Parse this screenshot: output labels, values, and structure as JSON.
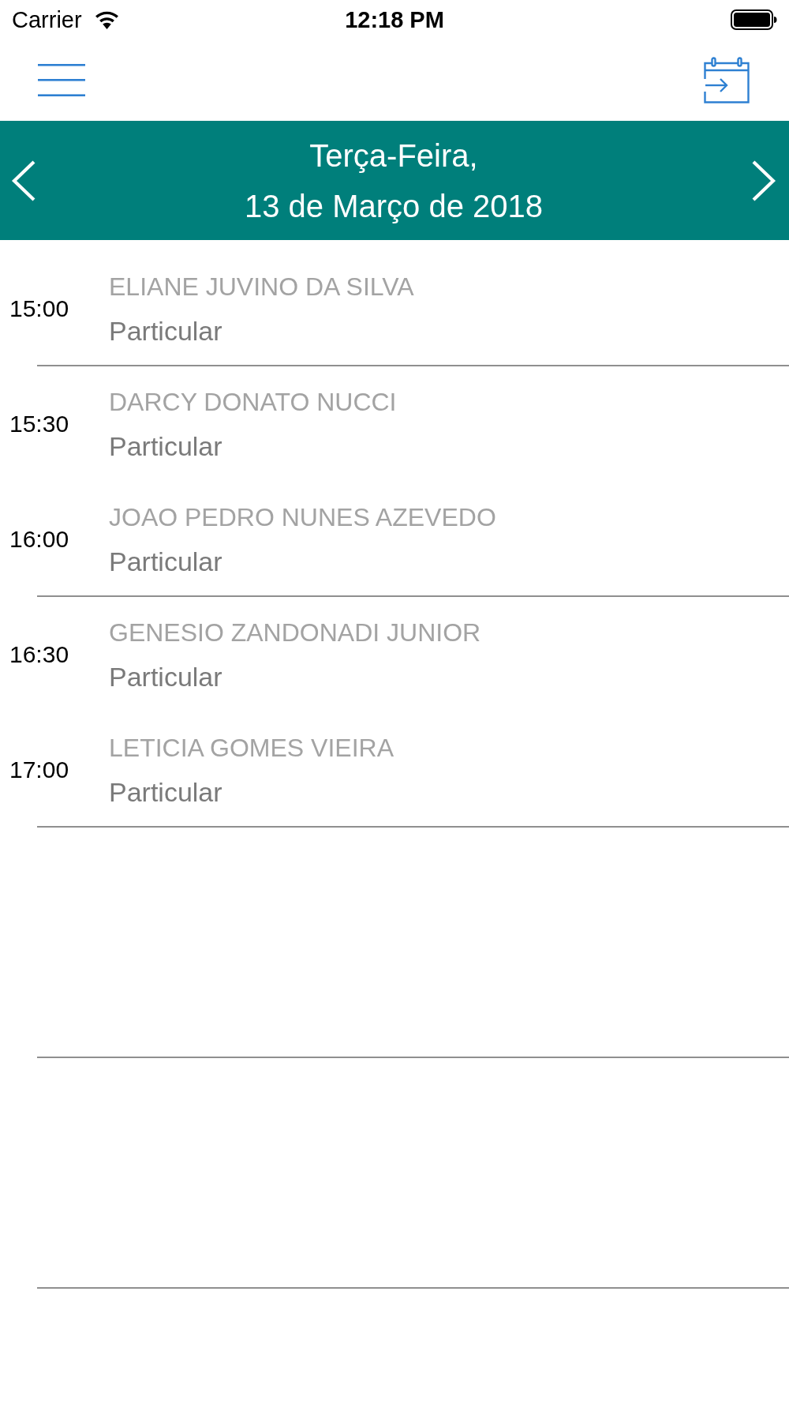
{
  "status_bar": {
    "carrier": "Carrier",
    "time": "12:18 PM"
  },
  "date_header": {
    "weekday": "Terça-Feira,",
    "date": "13 de Março de 2018"
  },
  "appointments": [
    {
      "time": "15:00",
      "patient": "ELIANE JUVINO DA SILVA",
      "type": "Particular"
    },
    {
      "time": "15:30",
      "patient": "DARCY DONATO NUCCI",
      "type": "Particular"
    },
    {
      "time": "16:00",
      "patient": "JOAO PEDRO NUNES AZEVEDO",
      "type": "Particular"
    },
    {
      "time": "16:30",
      "patient": "GENESIO ZANDONADI JUNIOR",
      "type": "Particular"
    },
    {
      "time": "17:00",
      "patient": "LETICIA GOMES VIEIRA",
      "type": "Particular"
    }
  ]
}
